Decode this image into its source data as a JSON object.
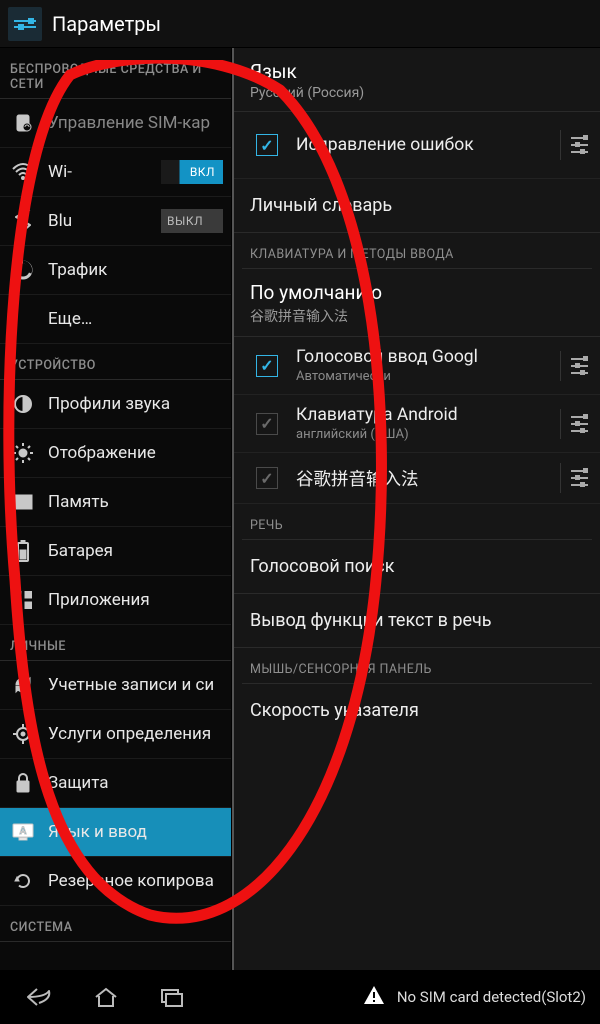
{
  "titlebar": {
    "title": "Параметры"
  },
  "sidebar": {
    "sections": [
      {
        "header": "БЕСПРОВОДНЫЕ СРЕДСТВА И СЕТИ",
        "items": [
          {
            "icon": "sim-icon",
            "label": "Управление SIM-кар"
          },
          {
            "icon": "wifi-icon",
            "label": "Wi-",
            "toggle": {
              "state": "on",
              "text": "ВКЛ"
            }
          },
          {
            "icon": "bluetooth-icon",
            "label": "Blu",
            "toggle": {
              "state": "off",
              "text": "ВЫКЛ"
            }
          },
          {
            "icon": "data-usage-icon",
            "label": "Трафик"
          },
          {
            "icon": "none",
            "label": "Еще…"
          }
        ]
      },
      {
        "header": "УСТРОЙСТВО",
        "items": [
          {
            "icon": "audio-icon",
            "label": "Профили звука"
          },
          {
            "icon": "display-icon",
            "label": "Отображение"
          },
          {
            "icon": "storage-icon",
            "label": "Память"
          },
          {
            "icon": "battery-icon",
            "label": "Батарея"
          },
          {
            "icon": "apps-icon",
            "label": "Приложения"
          }
        ]
      },
      {
        "header": "ЛИЧНЫЕ",
        "items": [
          {
            "icon": "sync-icon",
            "label": "Учетные записи и си"
          },
          {
            "icon": "location-icon",
            "label": "Услуги определения"
          },
          {
            "icon": "security-icon",
            "label": "Защита"
          },
          {
            "icon": "language-icon",
            "label": "Язык и ввод",
            "selected": true
          },
          {
            "icon": "backup-icon",
            "label": "Резервное копирова"
          }
        ]
      },
      {
        "header": "СИСТЕМА",
        "items": []
      }
    ]
  },
  "content": {
    "language": {
      "title": "Язык",
      "subtitle": "Русский (Россия)"
    },
    "spellcheck": {
      "label": "Исправление ошибок",
      "checked": true
    },
    "dictionary": {
      "label": "Личный словарь"
    },
    "cat_kb": "КЛАВИАТУРА И МЕТОДЫ ВВОДА",
    "default_kb": {
      "title": "По умолчанию",
      "subtitle": "谷歌拼音输入法"
    },
    "kb": [
      {
        "title": "Голосовой ввод Googl",
        "subtitle": "Автоматически",
        "checked": true,
        "locked": false
      },
      {
        "title": "Клавиатура Android",
        "subtitle": "английский (США)",
        "checked": true,
        "locked": true
      },
      {
        "title": "谷歌拼音输入法",
        "subtitle": "",
        "checked": true,
        "locked": true
      }
    ],
    "cat_speech": "РЕЧЬ",
    "voice_search": "Голосовой поиск",
    "tts": "Вывод функции текст в речь",
    "cat_mouse": "МЫШЬ/СЕНСОРНАЯ ПАНЕЛЬ",
    "pointer": "Скорость указателя"
  },
  "navbar": {
    "alert": "No SIM card detected(Slot2)"
  }
}
